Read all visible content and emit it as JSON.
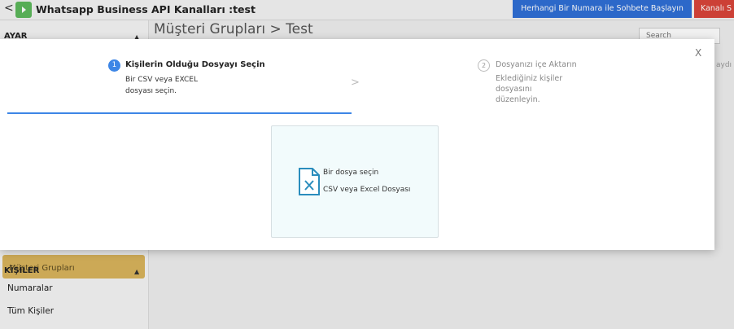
{
  "header": {
    "back_glyph": "<",
    "title": "Whatsapp Business API Kanalları :test",
    "start_chat_label": "Herhangi Bir Numara ile Sohbete Başlayın",
    "channel_label": "Kanalı S"
  },
  "sidebar": {
    "section1": "AYAR",
    "highlighted_item": "Müşteri Grupları",
    "section2": "KİŞİLER",
    "items": [
      "Numaralar",
      "Tüm Kişiler"
    ]
  },
  "main": {
    "title": "Müşteri Grupları > Test",
    "search_placeholder": "Search",
    "right_snippet": "aydı"
  },
  "modal": {
    "close_glyph": "X",
    "step1": {
      "number": "1",
      "title": "Kişilerin Olduğu Dosyayı Seçin",
      "desc": "Bir CSV veya EXCEL dosyası seçin."
    },
    "separator_glyph": ">",
    "step2": {
      "number": "2",
      "title": "Dosyanızı içe Aktarın",
      "desc": "Eklediğiniz kişiler dosyasını düzenleyin."
    },
    "dropzone": {
      "title": "Bir dosya seçin",
      "subtitle": "CSV veya Excel Dosyası"
    }
  },
  "colors": {
    "accent": "#3d86e6",
    "start_button": "#2f6fd6",
    "channel_button": "#d9453a",
    "highlight": "#d9b45c"
  }
}
